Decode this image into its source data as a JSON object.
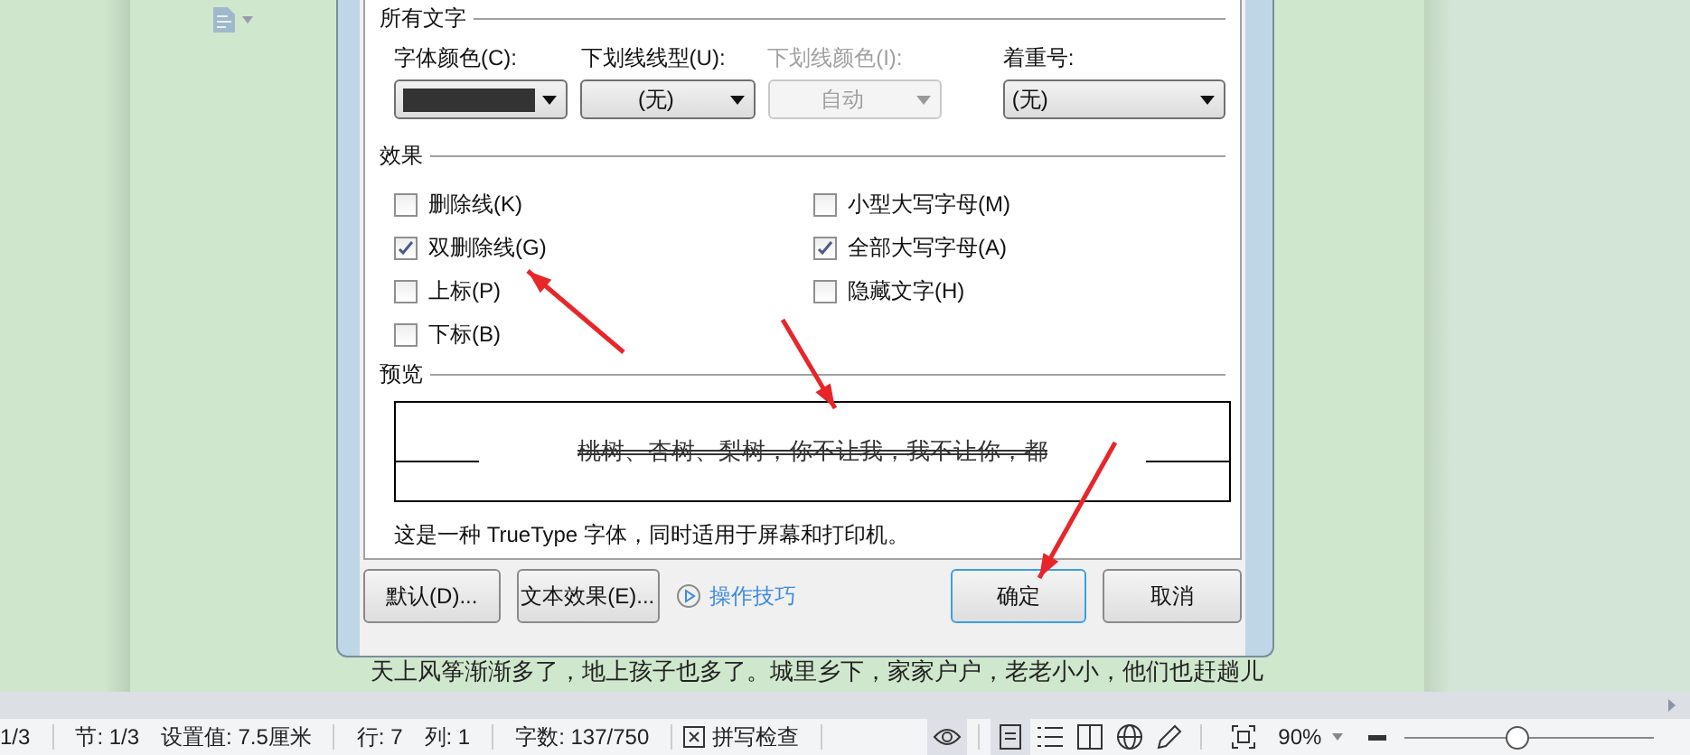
{
  "dialog": {
    "section_all_text": "所有文字",
    "fields": [
      {
        "label": "字体颜色(C):",
        "kind": "color",
        "color": "#333333",
        "disabled": false
      },
      {
        "label": "下划线线型(U):",
        "kind": "select",
        "value": "(无)",
        "disabled": false
      },
      {
        "label": "下划线颜色(I):",
        "kind": "select",
        "value": "自动",
        "disabled": true
      },
      {
        "label": "着重号:",
        "kind": "select",
        "value": "(无)",
        "disabled": false
      }
    ],
    "section_effects": "效果",
    "effects": [
      {
        "label": "删除线(K)",
        "checked": false
      },
      {
        "label": "双删除线(G)",
        "checked": true
      },
      {
        "label": "上标(P)",
        "checked": false
      },
      {
        "label": "下标(B)",
        "checked": false
      },
      {
        "label": "小型大写字母(M)",
        "checked": false
      },
      {
        "label": "全部大写字母(A)",
        "checked": true
      },
      {
        "label": "隐藏文字(H)",
        "checked": false
      }
    ],
    "section_preview": "预览",
    "preview_text": "桃树、杏树、梨树，你不让我，我不让你，都",
    "note": "这是一种 TrueType 字体，同时适用于屏幕和打印机。",
    "buttons": [
      {
        "label": "默认(D)...",
        "kind": "button"
      },
      {
        "label": "文本效果(E)...",
        "kind": "button"
      },
      {
        "label": "操作技巧",
        "kind": "link"
      },
      {
        "label": "确定",
        "kind": "primary"
      },
      {
        "label": "取消",
        "kind": "button"
      }
    ]
  },
  "document": {
    "line": "天上风筝渐渐多了，地上孩子也多了。城里乡下，家家户户，老老小小，他们也赶趟儿"
  },
  "status_bar": {
    "page": "1/3",
    "section": "节: 1/3",
    "position": "设置值: 7.5厘米",
    "row": "行: 7",
    "column": "列: 1",
    "word_count": "字数: 137/750",
    "spell_check": "拼写检查",
    "zoom": "90%",
    "zoom_slider": {
      "level": 0.45
    }
  }
}
